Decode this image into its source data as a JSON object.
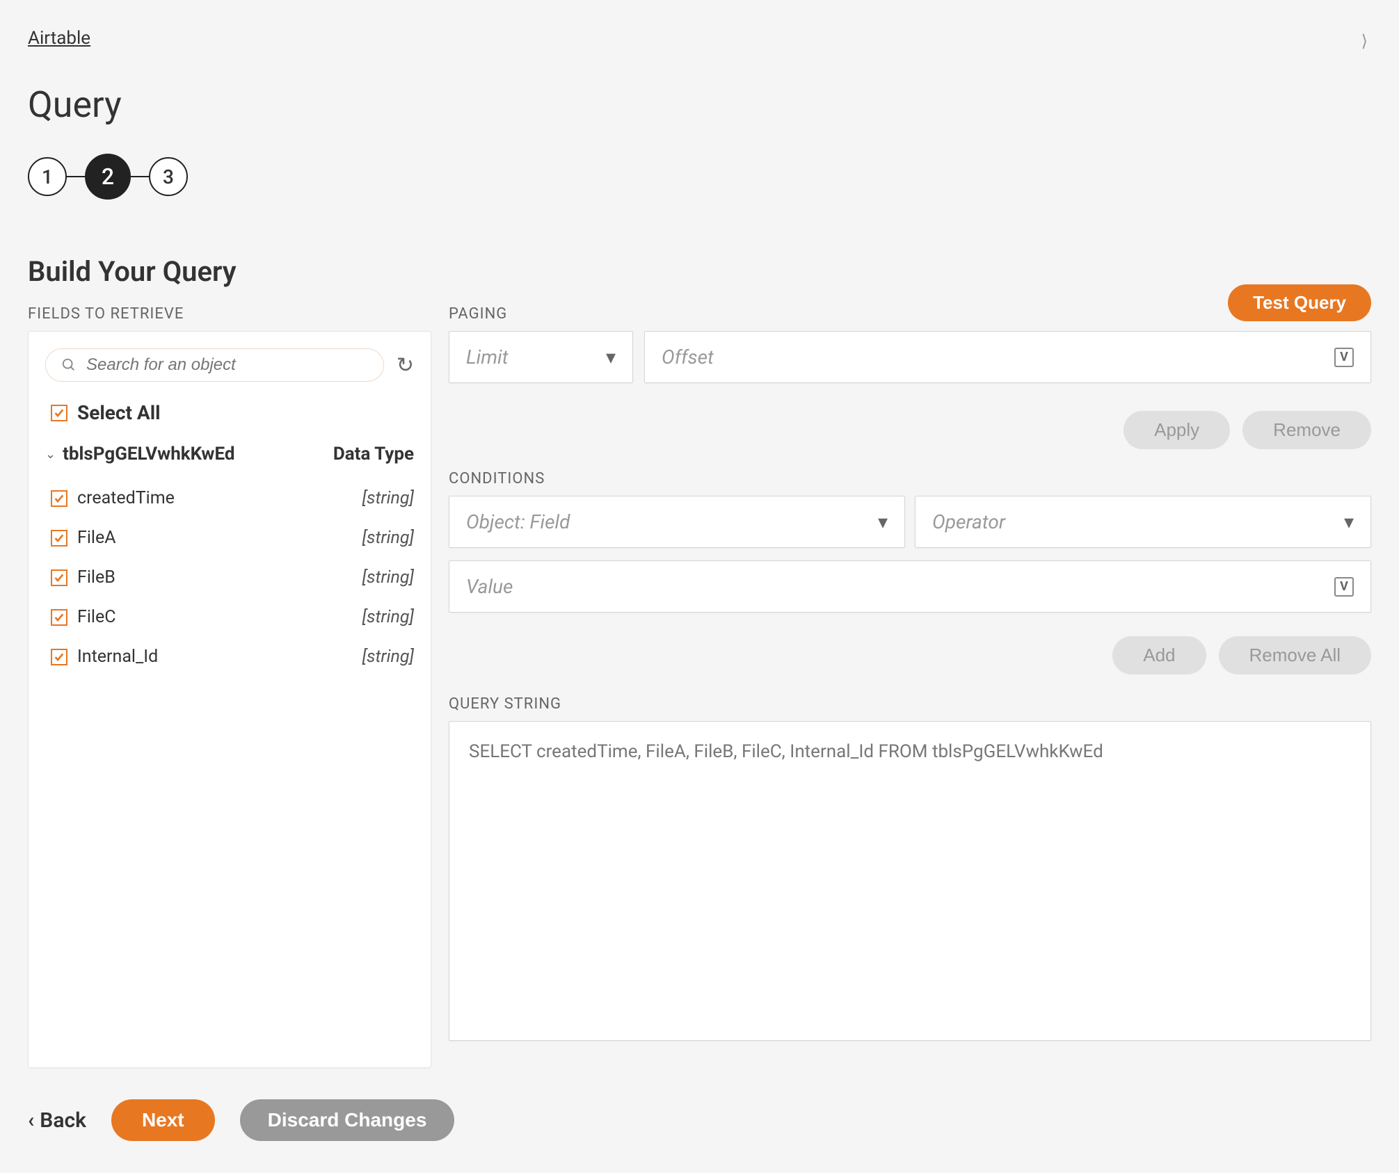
{
  "breadcrumb": "Airtable",
  "page_title": "Query",
  "stepper": {
    "steps": [
      "1",
      "2",
      "3"
    ],
    "active_index": 1
  },
  "section_title": "Build Your Query",
  "fields_panel": {
    "label": "FIELDS TO RETRIEVE",
    "search_placeholder": "Search for an object",
    "select_all": "Select All",
    "table_name": "tblsPgGELVwhkKwEd",
    "data_type_header": "Data Type",
    "fields": [
      {
        "name": "createdTime",
        "type": "[string]",
        "checked": true
      },
      {
        "name": "FileA",
        "type": "[string]",
        "checked": true
      },
      {
        "name": "FileB",
        "type": "[string]",
        "checked": true
      },
      {
        "name": "FileC",
        "type": "[string]",
        "checked": true
      },
      {
        "name": "Internal_Id",
        "type": "[string]",
        "checked": true
      }
    ]
  },
  "right": {
    "test_query": "Test Query",
    "paging_label": "PAGING",
    "limit_placeholder": "Limit",
    "offset_placeholder": "Offset",
    "apply": "Apply",
    "remove": "Remove",
    "conditions_label": "CONDITIONS",
    "object_field_placeholder": "Object: Field",
    "operator_placeholder": "Operator",
    "value_placeholder": "Value",
    "add": "Add",
    "remove_all": "Remove All",
    "query_string_label": "QUERY STRING",
    "query_string": "SELECT createdTime, FileA, FileB, FileC, Internal_Id FROM tblsPgGELVwhkKwEd"
  },
  "footer": {
    "back": "Back",
    "next": "Next",
    "discard": "Discard Changes"
  }
}
